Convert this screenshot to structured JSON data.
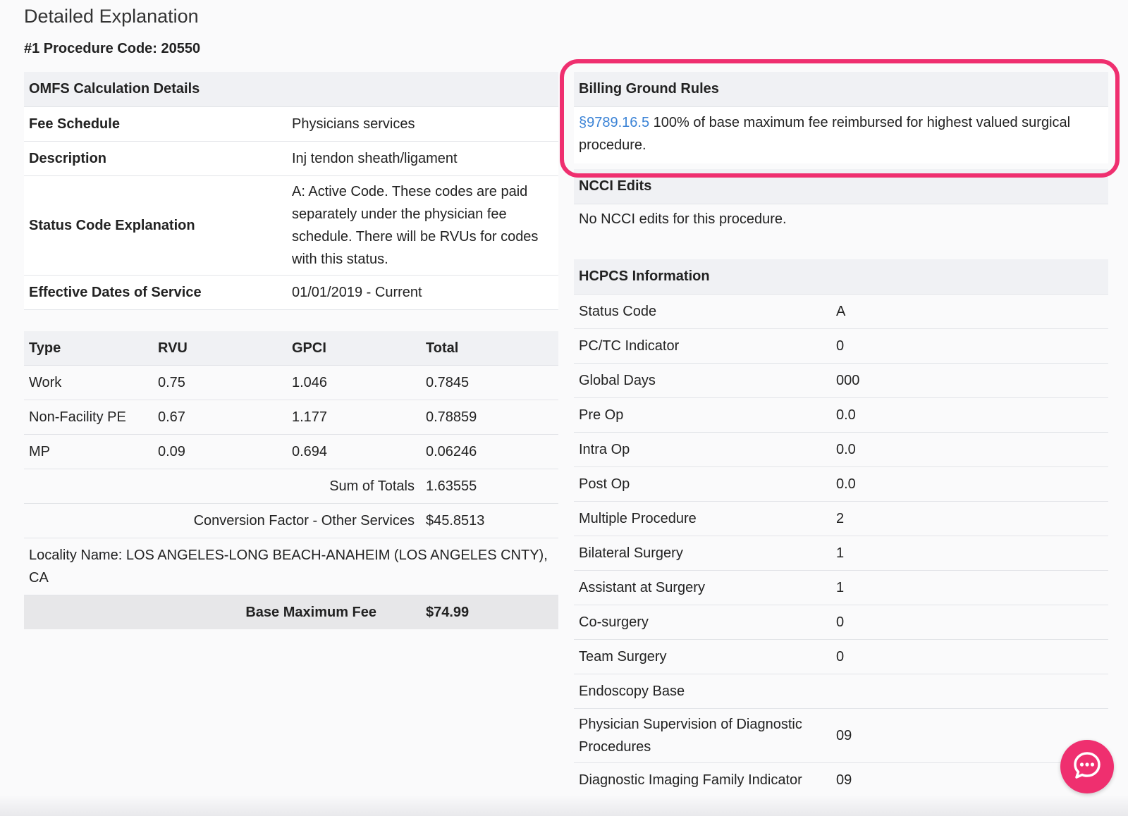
{
  "page": {
    "title": "Detailed Explanation",
    "subtitle": "#1 Procedure Code: 20550"
  },
  "omfs": {
    "heading": "OMFS Calculation Details",
    "rows": [
      {
        "key": "Fee Schedule",
        "value": "Physicians services"
      },
      {
        "key": "Description",
        "value": "Inj tendon sheath/ligament"
      },
      {
        "key": "Status Code Explanation",
        "value": "A: Active Code. These codes are paid separately under the physician fee schedule. There will be RVUs for codes with this status."
      },
      {
        "key": "Effective Dates of Service",
        "value": "01/01/2019 - Current"
      }
    ]
  },
  "rvu_table": {
    "headers": [
      "Type",
      "RVU",
      "GPCI",
      "Total"
    ],
    "rows": [
      [
        "Work",
        "0.75",
        "1.046",
        "0.7845"
      ],
      [
        "Non-Facility PE",
        "0.67",
        "1.177",
        "0.78859"
      ],
      [
        "MP",
        "0.09",
        "0.694",
        "0.06246"
      ]
    ],
    "sum_label": "Sum of Totals",
    "sum_value": "1.63555",
    "conversion_label": "Conversion Factor - Other Services",
    "conversion_value": "$45.8513",
    "locality": "Locality Name: LOS ANGELES-LONG BEACH-ANAHEIM (LOS ANGELES CNTY), CA",
    "base_fee_label": "Base Maximum Fee",
    "base_fee_value": "$74.99"
  },
  "billing": {
    "heading": "Billing Ground Rules",
    "link_text": "§9789.16.5",
    "text": " 100% of base maximum fee reimbursed for highest valued surgical procedure."
  },
  "ncci": {
    "heading": "NCCI Edits",
    "text": "No NCCI edits for this procedure."
  },
  "hcpcs": {
    "heading": "HCPCS Information",
    "rows": [
      {
        "key": "Status Code",
        "value": "A"
      },
      {
        "key": "PC/TC Indicator",
        "value": "0"
      },
      {
        "key": "Global Days",
        "value": "000"
      },
      {
        "key": "Pre Op",
        "value": "0.0"
      },
      {
        "key": "Intra Op",
        "value": "0.0"
      },
      {
        "key": "Post Op",
        "value": "0.0"
      },
      {
        "key": "Multiple Procedure",
        "value": "2"
      },
      {
        "key": "Bilateral Surgery",
        "value": "1"
      },
      {
        "key": "Assistant at Surgery",
        "value": "1"
      },
      {
        "key": "Co-surgery",
        "value": "0"
      },
      {
        "key": "Team Surgery",
        "value": "0"
      },
      {
        "key": "Endoscopy Base",
        "value": ""
      },
      {
        "key": "Physician Supervision of Diagnostic Procedures",
        "value": "09"
      },
      {
        "key": "Diagnostic Imaging Family Indicator",
        "value": "09"
      }
    ]
  },
  "colors": {
    "accent": "#ef2f6f",
    "link": "#3b83d6"
  },
  "icons": {
    "chat": "chat-bubble-icon"
  }
}
